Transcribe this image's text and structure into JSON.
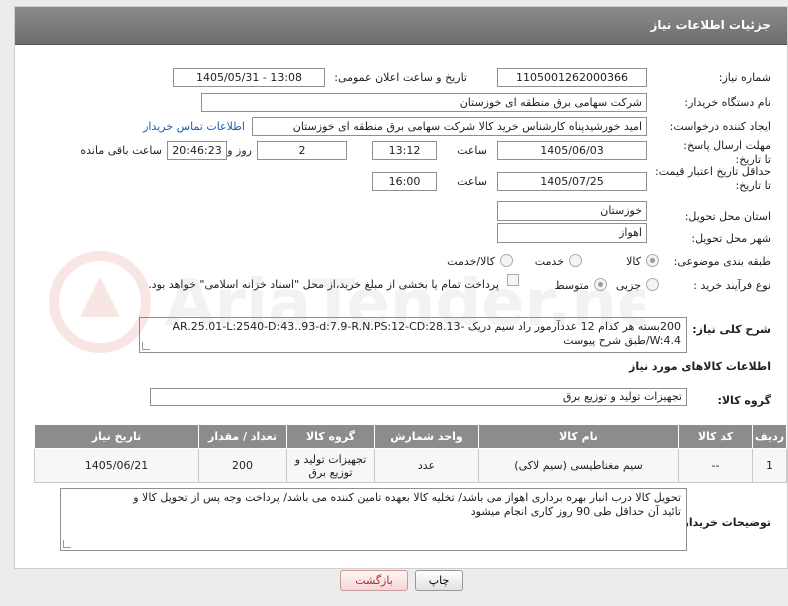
{
  "header": {
    "title": "جزئیات اطلاعات نیاز"
  },
  "fields": {
    "need_number_label": "شماره نیاز:",
    "need_number": "1105001262000366",
    "announce_label": "تاریخ و ساعت اعلان عمومی:",
    "announce_value": "1405/05/31 - 13:08",
    "buyer_org_label": "نام دستگاه خریدار:",
    "buyer_org": "شرکت سهامی برق منطقه ای خوزستان",
    "creator_label": "ایجاد کننده درخواست:",
    "creator": "امید خورشیدپناه کارشناس خرید کالا شرکت سهامی برق منطقه ای خوزستان",
    "contact_link": "اطلاعات تماس خریدار",
    "reply_deadline_label": "مهلت ارسال پاسخ: تا تاریخ:",
    "reply_date": "1405/06/03",
    "time_label": "ساعت",
    "reply_time": "13:12",
    "days_value": "2",
    "days_label": "روز و",
    "remaining_time": "20:46:23",
    "remaining_label": "ساعت باقی مانده",
    "price_validity_label": "حداقل تاریخ اعتبار قیمت: تا تاریخ:",
    "price_date": "1405/07/25",
    "price_time": "16:00",
    "province_label": "استان محل تحویل:",
    "province": "خوزستان",
    "city_label": "شهر محل تحویل:",
    "city": "اهواز",
    "category_label": "طبقه بندی موضوعی:",
    "category_options": [
      "کالا",
      "خدمت",
      "کالا/خدمت"
    ],
    "process_label": "نوع فرآیند خرید :",
    "process_options": [
      "جزیی",
      "متوسط"
    ],
    "payment_note": "پرداخت تمام یا بخشی از مبلغ خرید،از محل \"اسناد خزانه اسلامی\" خواهد بود."
  },
  "general_desc": {
    "label": "شرح کلی نیاز:",
    "line1": "200بسته هر کدام 12 عددآرمور راد سیم دریک -AR.25.01-L:2540-D:43..93-d:7.9-R.N.PS:12-CD:28.13",
    "line2": "W:4.4/طبق شرح پیوست"
  },
  "goods_info_title": "اطلاعات کالاهای مورد نیاز",
  "goods_group": {
    "label": "گروه کالا:",
    "value": "تجهیزات تولید و توزیع برق"
  },
  "table": {
    "headers": [
      "ردیف",
      "کد کالا",
      "نام کالا",
      "واحد شمارش",
      "گروه کالا",
      "تعداد / مقدار",
      "تاریخ نیاز"
    ],
    "rows": [
      {
        "row": "1",
        "code": "--",
        "name": "سیم مغناطیسی (سیم لاکی)",
        "unit": "عدد",
        "group_line1": "تجهیزات تولید و",
        "group_line2": "توزیع برق",
        "qty": "200",
        "date": "1405/06/21"
      }
    ]
  },
  "buyer_desc": {
    "label": "توضیحات خریدار:",
    "line1": "تحویل کالا درب انبار بهره برداری اهواز می باشد/ تخلیه کالا بعهده تامین کننده می باشد/ پرداخت وجه پس از تحویل کالا و",
    "line2": "تائید آن حداقل طی 90 روز کاری انجام میشود"
  },
  "buttons": {
    "print": "چاپ",
    "back": "بازگشت"
  },
  "watermark_text": "AriaTender.net"
}
